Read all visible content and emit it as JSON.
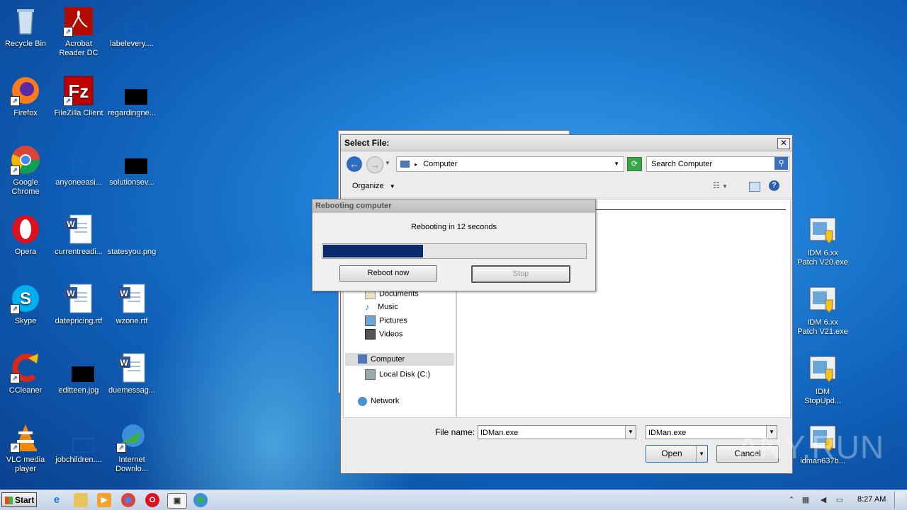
{
  "desktop": {
    "icons": [
      {
        "label": "Recycle Bin",
        "icon": "recycle-bin-icon"
      },
      {
        "label": "Acrobat Reader DC",
        "icon": "acrobat-icon"
      },
      {
        "label": "labelevery....",
        "icon": "blank-file-icon"
      },
      {
        "label": "Firefox",
        "icon": "firefox-icon"
      },
      {
        "label": "FileZilla Client",
        "icon": "filezilla-icon"
      },
      {
        "label": "regardingne...",
        "icon": "black-image-icon"
      },
      {
        "label": "Google Chrome",
        "icon": "chrome-icon"
      },
      {
        "label": "anyoneeasi...",
        "icon": "blank-file-icon"
      },
      {
        "label": "solutionsev...",
        "icon": "black-image-icon"
      },
      {
        "label": "Opera",
        "icon": "opera-icon"
      },
      {
        "label": "currentreadi...",
        "icon": "word-doc-icon"
      },
      {
        "label": "statesyou.png",
        "icon": "blank-file-icon"
      },
      {
        "label": "Skype",
        "icon": "skype-icon"
      },
      {
        "label": "datepricing.rtf",
        "icon": "word-doc-icon"
      },
      {
        "label": "wzone.rtf",
        "icon": "word-doc-icon"
      },
      {
        "label": "CCleaner",
        "icon": "ccleaner-icon"
      },
      {
        "label": "editteen.jpg",
        "icon": "black-image-icon"
      },
      {
        "label": "duemessag...",
        "icon": "word-doc-icon"
      },
      {
        "label": "VLC media player",
        "icon": "vlc-icon"
      },
      {
        "label": "jobchildren....",
        "icon": "blank-file-icon"
      },
      {
        "label": "Internet Downlo...",
        "icon": "idm-icon"
      },
      {
        "label": "IDM 6.xx Patch V20.exe",
        "icon": "installer-icon"
      },
      {
        "label": "IDM 6.xx Patch V21.exe",
        "icon": "installer-icon"
      },
      {
        "label": "IDM StopUpd...",
        "icon": "installer-icon"
      },
      {
        "label": "idman637b...",
        "icon": "installer-icon"
      }
    ]
  },
  "dialog": {
    "title": "Select File:",
    "address": "Computer",
    "search_placeholder": "Search Computer",
    "organize": "Organize",
    "nav_items": [
      "Documents",
      "Music",
      "Pictures",
      "Videos",
      "Computer",
      "Local Disk (C:)",
      "Network"
    ],
    "file_name_label": "File name:",
    "file_name_value": "IDMan.exe",
    "file_type_value": "IDMan.exe",
    "open_label": "Open",
    "cancel_label": "Cancel"
  },
  "reboot": {
    "title": "Rebooting computer",
    "message": "Rebooting in 12 seconds",
    "progress": 0.38,
    "reboot_now": "Reboot now",
    "stop": "Stop"
  },
  "taskbar": {
    "start": "Start",
    "clock": "8:27 AM"
  },
  "watermark": "ANY.RUN",
  "colors": {
    "progress_fill": "#0c2a6b",
    "title_bar": "#d6d6d6"
  }
}
